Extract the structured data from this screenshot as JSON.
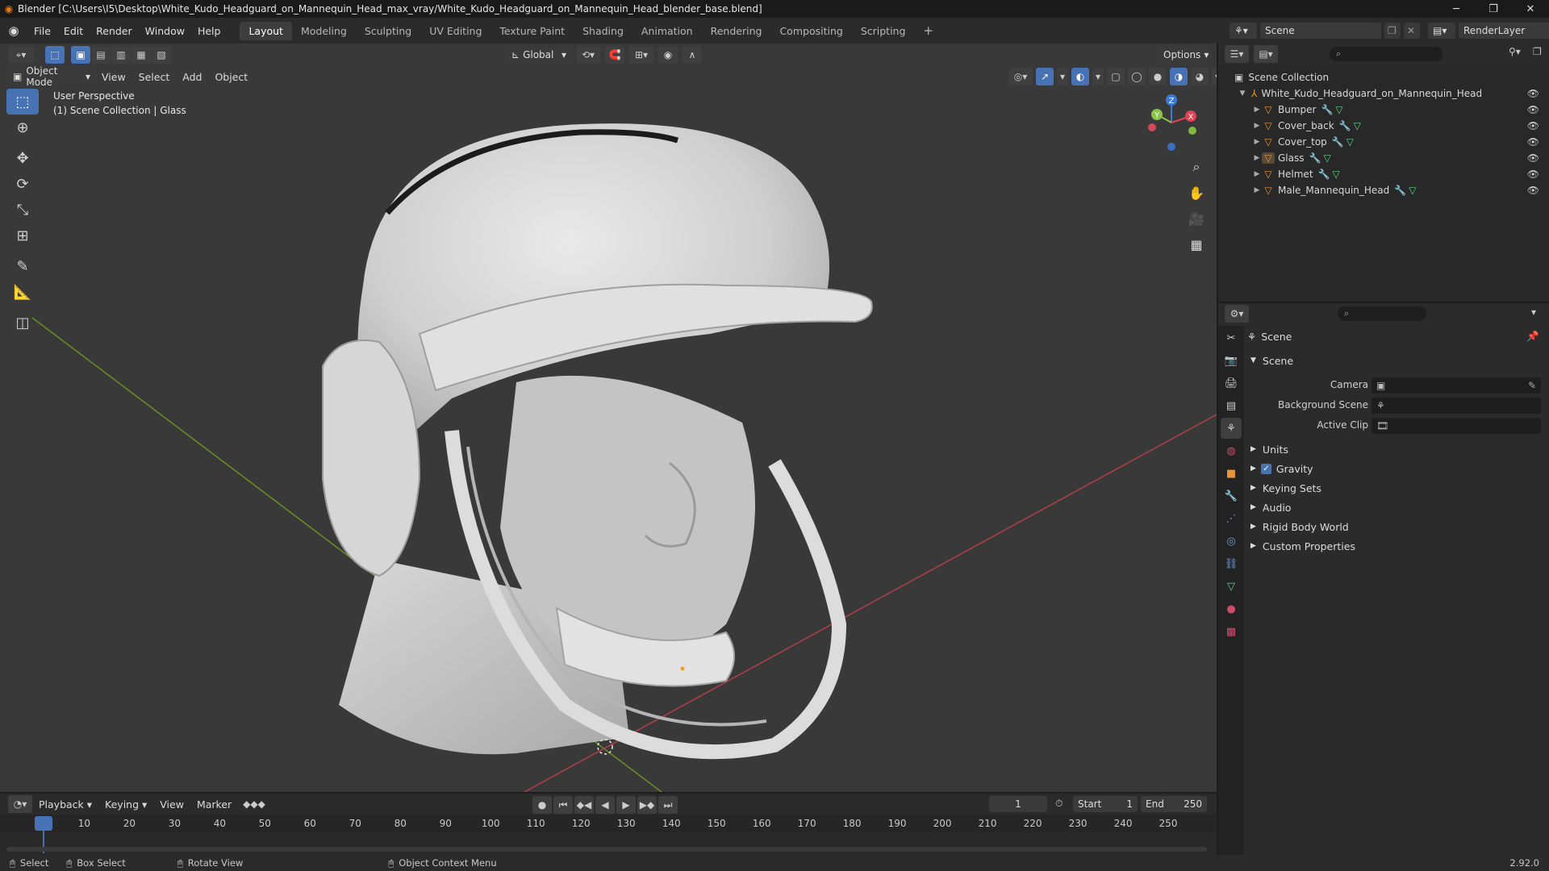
{
  "window": {
    "title": "Blender [C:\\Users\\I5\\Desktop\\White_Kudo_Headguard_on_Mannequin_Head_max_vray/White_Kudo_Headguard_on_Mannequin_Head_blender_base.blend]"
  },
  "menu": [
    "File",
    "Edit",
    "Render",
    "Window",
    "Help"
  ],
  "workspaces": [
    "Layout",
    "Modeling",
    "Sculpting",
    "UV Editing",
    "Texture Paint",
    "Shading",
    "Animation",
    "Rendering",
    "Compositing",
    "Scripting"
  ],
  "active_workspace": "Layout",
  "scene_selector": {
    "scene": "Scene",
    "layer": "RenderLayer"
  },
  "viewport": {
    "transform_orientation": "Global",
    "options_label": "Options",
    "mode": "Object Mode",
    "menus": [
      "View",
      "Select",
      "Add",
      "Object"
    ],
    "overlay_title": "User Perspective",
    "overlay_subtitle": "(1) Scene Collection | Glass",
    "gizmo_axes": {
      "x": "X",
      "y": "Y",
      "z": "Z"
    }
  },
  "outliner": {
    "root": "Scene Collection",
    "collection": "White_Kudo_Headguard_on_Mannequin_Head",
    "objects": [
      "Bumper",
      "Cover_back",
      "Cover_top",
      "Glass",
      "Helmet",
      "Male_Mannequin_Head"
    ]
  },
  "properties": {
    "header": "Scene",
    "section": "Scene",
    "fields": [
      {
        "label": "Camera"
      },
      {
        "label": "Background Scene"
      },
      {
        "label": "Active Clip"
      }
    ],
    "panels": [
      "Units",
      "Gravity",
      "Keying Sets",
      "Audio",
      "Rigid Body World",
      "Custom Properties"
    ],
    "gravity_checked": true
  },
  "timeline": {
    "menus": [
      "Playback",
      "Keying",
      "View",
      "Marker"
    ],
    "current_frame": "1",
    "start_label": "Start",
    "start": "1",
    "end_label": "End",
    "end": "250",
    "ticks": [
      "1",
      "10",
      "20",
      "30",
      "40",
      "50",
      "60",
      "70",
      "80",
      "90",
      "100",
      "110",
      "120",
      "130",
      "140",
      "150",
      "160",
      "170",
      "180",
      "190",
      "200",
      "210",
      "220",
      "230",
      "240",
      "250"
    ]
  },
  "statusbar": {
    "select": "Select",
    "box_select": "Box Select",
    "rotate_view": "Rotate View",
    "context_menu": "Object Context Menu",
    "version": "2.92.0"
  },
  "colors": {
    "accent": "#4772b3",
    "object_orange": "#e8953a",
    "axis_x": "#e04454",
    "axis_y": "#8bc34a",
    "axis_z": "#3b7bd6"
  }
}
